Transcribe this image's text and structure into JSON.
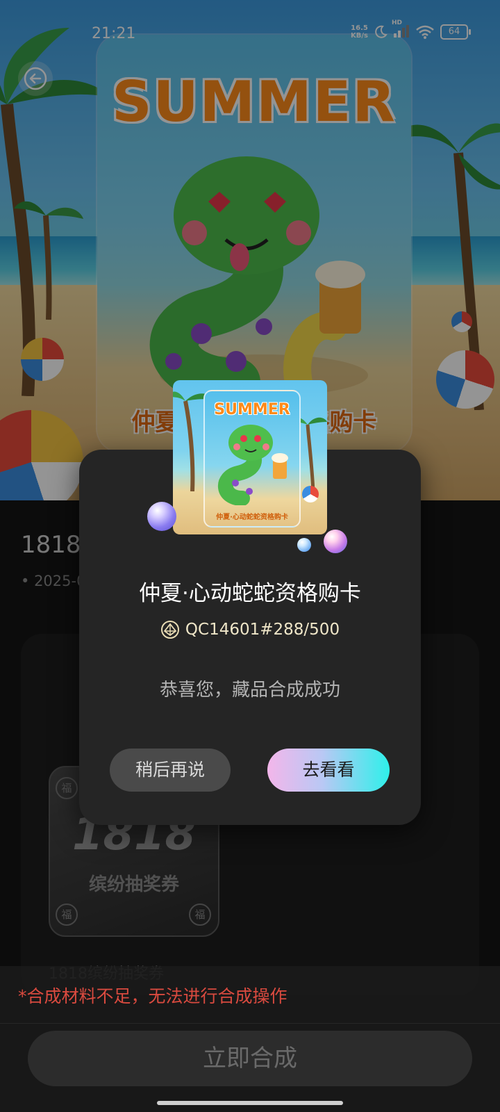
{
  "status_bar": {
    "time": "21:21",
    "net_speed_value": "16.5",
    "net_speed_unit": "KB/s",
    "hd_label": "HD",
    "battery": "64"
  },
  "hero": {
    "card_title": "SUMMER",
    "card_caption": "仲夏·心动蛇蛇资格购卡"
  },
  "page": {
    "title": "1818专",
    "date": "2025-0",
    "voucher_number": "1818",
    "voucher_label": "缤纷抽奖券",
    "voucher_fu": "福",
    "item_label": "1818缤纷抽奖券"
  },
  "dialog": {
    "card_title": "SUMMER",
    "card_caption": "仲夏·心动蛇蛇资格购卡",
    "title": "仲夏·心动蛇蛇资格购卡",
    "serial": "QC14601#288/500",
    "message": "恭喜您，藏品合成成功",
    "later_button": "稍后再说",
    "view_button": "去看看"
  },
  "bottom": {
    "warning": "*合成材料不足，无法进行合成操作",
    "synthesize_button": "立即合成"
  },
  "colors": {
    "accent_gradient_start": "#f3b6ea",
    "accent_gradient_end": "#2ef0ea",
    "warning": "#d94a3f",
    "dialog_bg": "#252525"
  }
}
